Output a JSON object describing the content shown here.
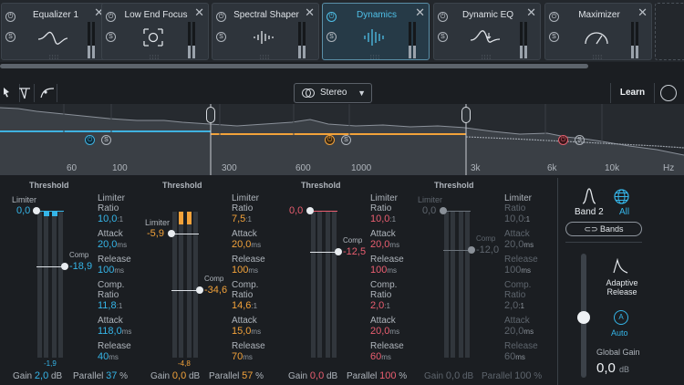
{
  "modules": [
    {
      "name": "Equalizer 1",
      "icon": "eq-curve-icon",
      "active": false
    },
    {
      "name": "Low End Focus",
      "icon": "focus-frame-icon",
      "active": false
    },
    {
      "name": "Spectral Shaper",
      "icon": "spectral-lines-icon",
      "active": false
    },
    {
      "name": "Dynamics",
      "icon": "dynamics-lines-icon",
      "active": true
    },
    {
      "name": "Dynamic EQ",
      "icon": "dynamic-eq-icon",
      "active": false
    },
    {
      "name": "Maximizer",
      "icon": "gauge-icon",
      "active": false
    }
  ],
  "module_controls": {
    "close": "✕",
    "power": "⏻",
    "solo": "S",
    "dots": "∷∷"
  },
  "toolbar": {
    "stereo_mode": "Stereo",
    "learn": "Learn"
  },
  "spectrum": {
    "freq_labels": [
      "60",
      "100",
      "300",
      "600",
      "1000",
      "3k",
      "6k",
      "10k",
      "Hz"
    ]
  },
  "bands": [
    {
      "threshold_title": "Threshold",
      "limiter_label": "Limiter",
      "limiter_value": "0,0",
      "comp_label": "Comp",
      "comp_value": "-18,9",
      "meter_low": "-1,9",
      "color": "#35b5e8",
      "params": {
        "limiter_title": "Limiter",
        "limiter_ratio_label": "Ratio",
        "limiter_ratio": "10,0",
        "limiter_ratio_unit": ":1",
        "limiter_attack_label": "Attack",
        "limiter_attack": "20,0",
        "limiter_attack_unit": "ms",
        "limiter_release_label": "Release",
        "limiter_release": "100",
        "limiter_release_unit": "ms",
        "comp_title": "Comp.",
        "comp_ratio_label": "Ratio",
        "comp_ratio": "11,8",
        "comp_ratio_unit": ":1",
        "comp_attack_label": "Attack",
        "comp_attack": "118,0",
        "comp_attack_unit": "ms",
        "comp_release_label": "Release",
        "comp_release": "40",
        "comp_release_unit": "ms"
      },
      "gain_label": "Gain",
      "gain": "2,0",
      "gain_unit": "dB",
      "parallel_label": "Parallel",
      "parallel": "37",
      "parallel_unit": "%"
    },
    {
      "threshold_title": "Threshold",
      "limiter_label": "Limiter",
      "limiter_value": "-5,9",
      "comp_label": "Comp",
      "comp_value": "-34,6",
      "meter_low": "-4,8",
      "color": "#f2a23a",
      "params": {
        "limiter_title": "Limiter",
        "limiter_ratio_label": "Ratio",
        "limiter_ratio": "7,5",
        "limiter_ratio_unit": ":1",
        "limiter_attack_label": "Attack",
        "limiter_attack": "20,0",
        "limiter_attack_unit": "ms",
        "limiter_release_label": "Release",
        "limiter_release": "100",
        "limiter_release_unit": "ms",
        "comp_title": "Comp.",
        "comp_ratio_label": "Ratio",
        "comp_ratio": "14,6",
        "comp_ratio_unit": ":1",
        "comp_attack_label": "Attack",
        "comp_attack": "15,0",
        "comp_attack_unit": "ms",
        "comp_release_label": "Release",
        "comp_release": "70",
        "comp_release_unit": "ms"
      },
      "gain_label": "Gain",
      "gain": "0,0",
      "gain_unit": "dB",
      "parallel_label": "Parallel",
      "parallel": "57",
      "parallel_unit": "%"
    },
    {
      "threshold_title": "Threshold",
      "limiter_label": "Limiter",
      "limiter_value": "0,0",
      "comp_label": "Comp",
      "comp_value": "-12,5",
      "meter_low": "",
      "color": "#ea5e70",
      "params": {
        "limiter_title": "Limiter",
        "limiter_ratio_label": "Ratio",
        "limiter_ratio": "10,0",
        "limiter_ratio_unit": ":1",
        "limiter_attack_label": "Attack",
        "limiter_attack": "20,0",
        "limiter_attack_unit": "ms",
        "limiter_release_label": "Release",
        "limiter_release": "100",
        "limiter_release_unit": "ms",
        "comp_title": "Comp.",
        "comp_ratio_label": "Ratio",
        "comp_ratio": "2,0",
        "comp_ratio_unit": ":1",
        "comp_attack_label": "Attack",
        "comp_attack": "20,0",
        "comp_attack_unit": "ms",
        "comp_release_label": "Release",
        "comp_release": "60",
        "comp_release_unit": "ms"
      },
      "gain_label": "Gain",
      "gain": "0,0",
      "gain_unit": "dB",
      "parallel_label": "Parallel",
      "parallel": "100",
      "parallel_unit": "%"
    },
    {
      "threshold_title": "Threshold",
      "limiter_label": "Limiter",
      "limiter_value": "0,0",
      "comp_label": "Comp",
      "comp_value": "-12,0",
      "meter_low": "",
      "color": "#5e656d",
      "params": {
        "limiter_title": "Limiter",
        "limiter_ratio_label": "Ratio",
        "limiter_ratio": "10,0",
        "limiter_ratio_unit": ":1",
        "limiter_attack_label": "Attack",
        "limiter_attack": "20,0",
        "limiter_attack_unit": "ms",
        "limiter_release_label": "Release",
        "limiter_release": "100",
        "limiter_release_unit": "ms",
        "comp_title": "Comp.",
        "comp_ratio_label": "Ratio",
        "comp_ratio": "2,0",
        "comp_ratio_unit": ":1",
        "comp_attack_label": "Attack",
        "comp_attack": "20,0",
        "comp_attack_unit": "ms",
        "comp_release_label": "Release",
        "comp_release": "60",
        "comp_release_unit": "ms"
      },
      "gain_label": "Gain",
      "gain": "0,0",
      "gain_unit": "dB",
      "parallel_label": "Parallel",
      "parallel": "100",
      "parallel_unit": "%"
    }
  ],
  "global": {
    "band_label": "Band 2",
    "all_label": "All",
    "bands_button": "⊂⊃ Bands",
    "adaptive_release": "Adaptive Release",
    "auto_icon": "A",
    "auto_label": "Auto",
    "global_gain_label": "Global Gain",
    "global_gain_value": "0,0",
    "global_gain_unit": "dB"
  },
  "colors": {
    "accent": "#35b5e8",
    "band2": "#f2a23a",
    "band3": "#ea5e70"
  }
}
